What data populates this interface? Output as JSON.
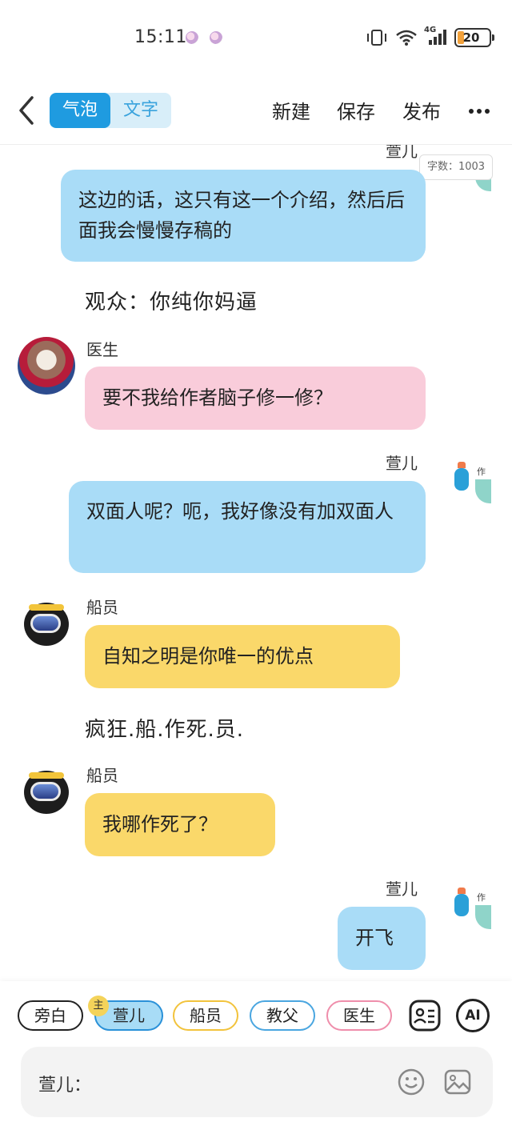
{
  "status_bar": {
    "time": "15:11",
    "battery": "20",
    "network": "4G"
  },
  "header": {
    "toggle_bubble": "气泡",
    "toggle_text": "文字",
    "new_label": "新建",
    "save_label": "保存",
    "publish_label": "发布"
  },
  "word_count": "字数：1003",
  "messages": [
    {
      "speaker": "萱儿",
      "text": "这边的话，这只有这一个介绍，然后后面我会慢慢存稿的"
    },
    {
      "narration": "观众：你纯你妈逼"
    },
    {
      "speaker": "医生",
      "text": "要不我给作者脑子修一修？"
    },
    {
      "speaker": "萱儿",
      "text": "双面人呢？呃，我好像没有加双面人"
    },
    {
      "speaker": "船员",
      "text": "自知之明是你唯一的优点"
    },
    {
      "narration": "疯狂.船.作死.员."
    },
    {
      "speaker": "船员",
      "text": "我哪作死了？"
    },
    {
      "speaker": "萱儿",
      "text": "开飞"
    }
  ],
  "avatar_tag": "作",
  "roles": {
    "narration": "旁白",
    "self": "萱儿",
    "crew": "船员",
    "godfather": "教父",
    "doctor": "医生",
    "main_badge": "主",
    "ai": "AI"
  },
  "input": {
    "speaker_label": "萱儿：",
    "placeholder": ""
  },
  "colors": {
    "accent": "#1f9be0",
    "blue_bubble": "#a9dcf7",
    "pink_bubble": "#f9ccda",
    "yellow_bubble": "#fad86a"
  }
}
